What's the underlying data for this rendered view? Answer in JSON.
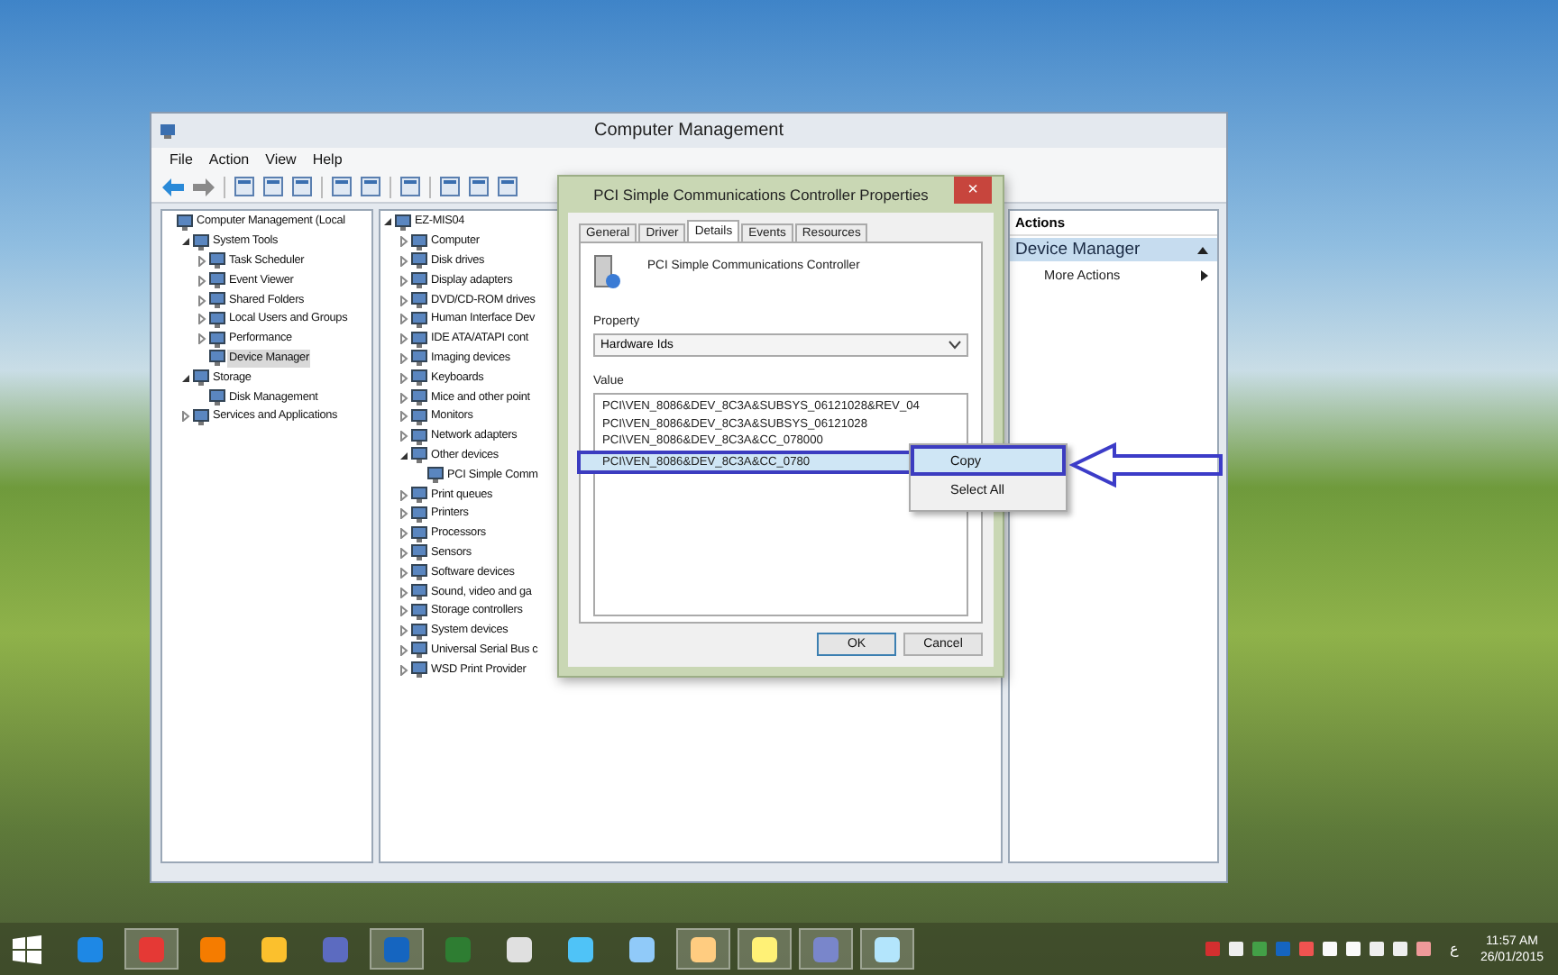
{
  "window": {
    "title": "Computer Management",
    "menu": [
      "File",
      "Action",
      "View",
      "Help"
    ]
  },
  "nav_tree": [
    {
      "label": "Computer Management (Local",
      "selected": false,
      "children": [
        {
          "label": "System Tools",
          "expanded": true,
          "selected": false,
          "children": [
            {
              "label": "Task Scheduler",
              "expanded": false,
              "selected": false
            },
            {
              "label": "Event Viewer",
              "expanded": false,
              "selected": false
            },
            {
              "label": "Shared Folders",
              "expanded": false,
              "selected": false
            },
            {
              "label": "Local Users and Groups",
              "expanded": false,
              "selected": false
            },
            {
              "label": "Performance",
              "expanded": false,
              "selected": false
            },
            {
              "label": "Device Manager",
              "selected": true
            }
          ]
        },
        {
          "label": "Storage",
          "expanded": true,
          "selected": false,
          "children": [
            {
              "label": "Disk Management",
              "selected": false
            }
          ]
        },
        {
          "label": "Services and Applications",
          "expanded": false,
          "selected": false
        }
      ]
    }
  ],
  "device_tree": [
    {
      "label": "EZ-MIS04",
      "expanded": true,
      "children": [
        {
          "label": "Computer",
          "expanded": false
        },
        {
          "label": "Disk drives",
          "expanded": false
        },
        {
          "label": "Display adapters",
          "expanded": false
        },
        {
          "label": "DVD/CD-ROM drives",
          "expanded": false
        },
        {
          "label": "Human Interface Dev",
          "expanded": false
        },
        {
          "label": "IDE ATA/ATAPI cont",
          "expanded": false
        },
        {
          "label": "Imaging devices",
          "expanded": false
        },
        {
          "label": "Keyboards",
          "expanded": false
        },
        {
          "label": "Mice and other point",
          "expanded": false
        },
        {
          "label": "Monitors",
          "expanded": false
        },
        {
          "label": "Network adapters",
          "expanded": false
        },
        {
          "label": "Other devices",
          "expanded": true,
          "children": [
            {
              "label": "PCI Simple Comm"
            }
          ]
        },
        {
          "label": "Print queues",
          "expanded": false
        },
        {
          "label": "Printers",
          "expanded": false
        },
        {
          "label": "Processors",
          "expanded": false
        },
        {
          "label": "Sensors",
          "expanded": false
        },
        {
          "label": "Software devices",
          "expanded": false
        },
        {
          "label": "Sound, video and ga",
          "expanded": false
        },
        {
          "label": "Storage controllers",
          "expanded": false
        },
        {
          "label": "System devices",
          "expanded": false
        },
        {
          "label": "Universal Serial Bus c",
          "expanded": false
        },
        {
          "label": "WSD Print Provider",
          "expanded": false
        }
      ]
    }
  ],
  "actions": {
    "header": "Actions",
    "section": "Device Manager",
    "items": [
      "More Actions"
    ]
  },
  "dialog": {
    "title": "PCI Simple Communications Controller Properties",
    "close": "×",
    "tabs": [
      {
        "label": "General",
        "selected": false
      },
      {
        "label": "Driver",
        "selected": false
      },
      {
        "label": "Details",
        "selected": true
      },
      {
        "label": "Events",
        "selected": false
      },
      {
        "label": "Resources",
        "selected": false
      }
    ],
    "device_name": "PCI Simple Communications Controller",
    "property_label": "Property",
    "property_value": "Hardware Ids",
    "value_label": "Value",
    "values": [
      {
        "text": "PCI\\VEN_8086&DEV_8C3A&SUBSYS_06121028&REV_04",
        "selected": false
      },
      {
        "text": "PCI\\VEN_8086&DEV_8C3A&SUBSYS_06121028",
        "selected": false
      },
      {
        "text": "PCI\\VEN_8086&DEV_8C3A&CC_078000",
        "selected": false
      },
      {
        "text": "PCI\\VEN_8086&DEV_8C3A&CC_0780",
        "selected": true
      }
    ],
    "buttons": [
      "OK",
      "Cancel"
    ]
  },
  "context_menu": [
    {
      "label": "Copy",
      "selected": true
    },
    {
      "label": "Select All",
      "selected": false
    }
  ],
  "taskbar": {
    "apps": [
      {
        "running": false
      },
      {
        "running": true
      },
      {
        "running": false
      },
      {
        "running": false
      },
      {
        "running": false
      },
      {
        "running": true
      },
      {
        "running": false
      },
      {
        "running": false
      },
      {
        "running": false
      },
      {
        "running": false
      },
      {
        "running": true
      },
      {
        "running": true
      },
      {
        "running": true
      },
      {
        "running": true
      }
    ],
    "language": "ع",
    "time": "11:57 AM",
    "date": "26/01/2015"
  }
}
